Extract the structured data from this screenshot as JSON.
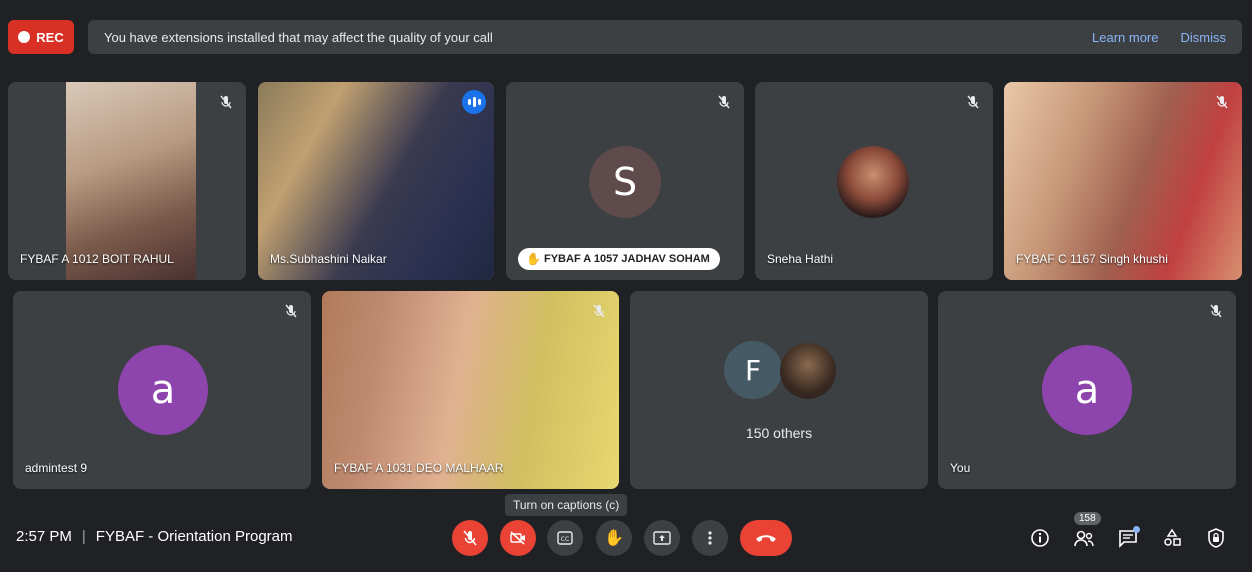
{
  "recording": {
    "label": "REC"
  },
  "banner": {
    "message": "You have extensions installed that may affect the quality of your call",
    "learn_more": "Learn more",
    "dismiss": "Dismiss"
  },
  "tiles": [
    {
      "name": "FYBAF A 1012 BOIT RAHUL"
    },
    {
      "name": "Ms.Subhashini Naikar"
    },
    {
      "name": "FYBAF A 1057 JADHAV SOHAM",
      "avatar_letter": "S"
    },
    {
      "name": "Sneha Hathi"
    },
    {
      "name": "FYBAF C 1167 Singh khushi"
    },
    {
      "name": "admintest 9",
      "avatar_letter": "a"
    },
    {
      "name": "FYBAF A 1031 DEO MALHAAR"
    },
    {
      "avatar_letter": "F",
      "others_label": "150 others"
    },
    {
      "name": "You",
      "avatar_letter": "a"
    }
  ],
  "tooltip": {
    "captions": "Turn on captions (c)"
  },
  "footer": {
    "time": "2:57 PM",
    "separator": "|",
    "meeting_title": "FYBAF - Orientation Program",
    "participants_count": "158"
  },
  "colors": {
    "background": "#202124",
    "tile": "#3c4043",
    "red": "#ea4335",
    "purple_avatar": "#8e44ad",
    "accent_blue": "#8ab4f8"
  }
}
